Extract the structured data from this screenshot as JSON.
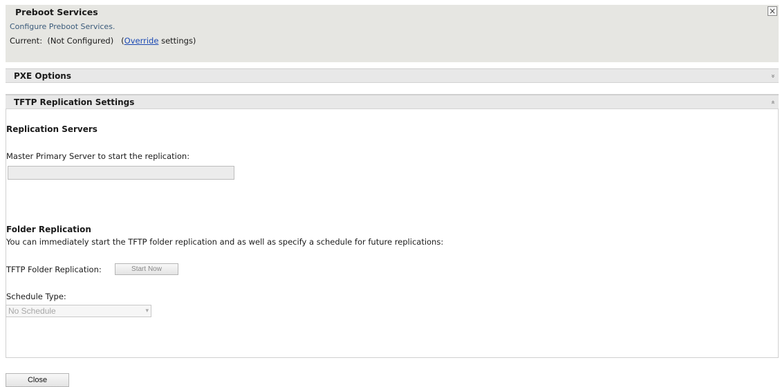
{
  "preboot": {
    "title": "Preboot Services",
    "description": "Configure Preboot Services.",
    "current_prefix": "Current:  (Not Configured)   (",
    "override_link": "Override",
    "current_suffix": " settings)",
    "close_icon": "×"
  },
  "pxe": {
    "title": "PXE Options",
    "chevron": "»"
  },
  "tftp": {
    "title": "TFTP Replication Settings",
    "chevron": "«",
    "replication_servers_heading": "Replication Servers",
    "master_label": "Master Primary Server to start the replication:",
    "master_value": "",
    "folder_heading": "Folder Replication",
    "folder_desc": "You can immediately start the TFTP folder replication and as well as specify a schedule for future replications:",
    "folder_replication_label": "TFTP Folder Replication:",
    "start_now_label": "Start Now",
    "schedule_type_label": "Schedule Type:",
    "schedule_type_value": "No Schedule"
  },
  "footer": {
    "close_label": "Close"
  }
}
